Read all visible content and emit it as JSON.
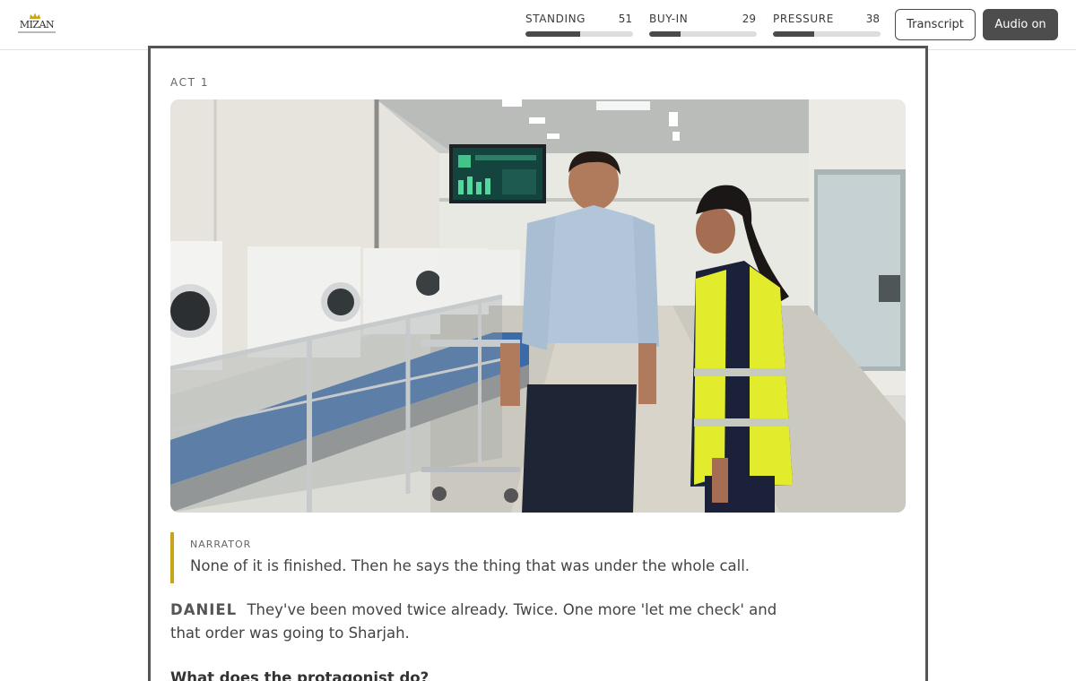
{
  "brand": {
    "logo_text": "MIZAN"
  },
  "header": {
    "meters": [
      {
        "label": "STANDING",
        "value": "51",
        "level": 0.51
      },
      {
        "label": "BUY-IN",
        "value": "29",
        "level": 0.29
      },
      {
        "label": "PRESSURE",
        "value": "38",
        "level": 0.38
      }
    ],
    "transcript_label": "Transcript",
    "audio_label": "Audio on"
  },
  "scene": {
    "act_label": "ACT 1",
    "image_icon": "factory-scene-illustration"
  },
  "narration": {
    "speaker": "NARRATOR",
    "text": "None of it is finished. Then he says the thing that was under the whole call."
  },
  "dialogue": {
    "speaker": "DANIEL",
    "text": "They've been moved twice already. Twice. One more 'let me check' and that order was going to Sharjah."
  },
  "prompt": {
    "question": "What does the protagonist do?"
  },
  "colors": {
    "accent_gold": "#c9a417",
    "meter_fill": "#4a4a4a",
    "button_dark": "#4d4d4d"
  }
}
